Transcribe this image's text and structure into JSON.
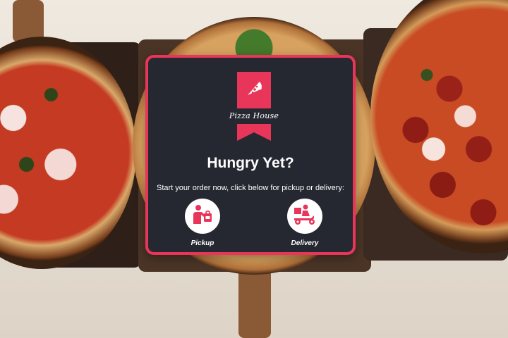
{
  "brand": {
    "name": "Pizza House",
    "icon": "pizza-slice-icon",
    "accent_color": "#e8355a",
    "card_color": "#252830"
  },
  "modal": {
    "title": "Hungry Yet?",
    "subtitle": "Start your order now, click below for pickup or delivery:"
  },
  "options": [
    {
      "label": "Pickup",
      "icon": "pickup-person-bag-icon"
    },
    {
      "label": "Delivery",
      "icon": "delivery-scooter-icon"
    }
  ]
}
